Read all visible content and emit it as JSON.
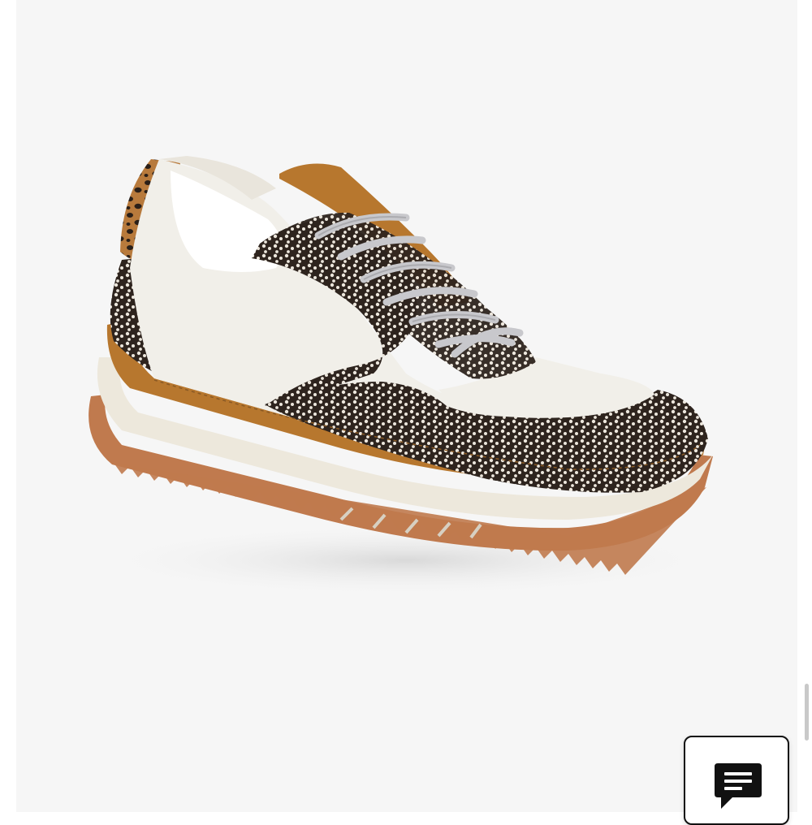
{
  "colors": {
    "page_background": "#ffffff",
    "image_background": "#f6f6f6",
    "white_leather": "#f1efe9",
    "suede_tan": "#b7772e",
    "gum_sole": "#c07a4e",
    "spotted_calf_hair": "#3b2e26",
    "laces": "#c8c8cc",
    "chat_button_border": "#111111"
  },
  "product_image": {
    "subject": "sneaker",
    "icon": "product-photo"
  },
  "chat_widget": {
    "icon": "chat-message-icon"
  }
}
